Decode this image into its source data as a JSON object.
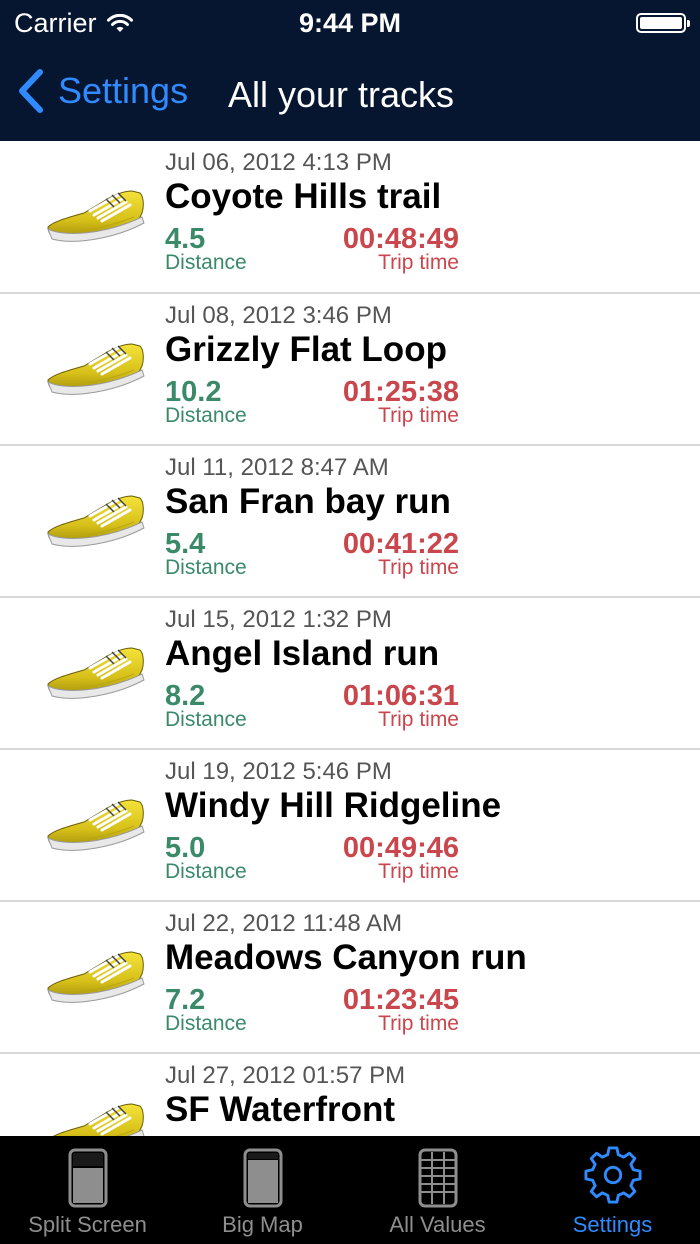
{
  "status_bar": {
    "carrier": "Carrier",
    "time": "9:44 PM",
    "battery_level": 1.0
  },
  "nav": {
    "back_label": "Settings",
    "title": "All your tracks"
  },
  "colors": {
    "header_bg": "#061530",
    "accent": "#2f8bff",
    "distance": "#3a8a6a",
    "trip_time": "#c9464c"
  },
  "tracks": [
    {
      "date": "Jul 06, 2012 4:13 PM",
      "name": "Coyote Hills trail",
      "distance": "4.5",
      "distance_label": "Distance",
      "trip_time": "00:48:49",
      "trip_time_label": "Trip time"
    },
    {
      "date": "Jul 08, 2012 3:46 PM",
      "name": "Grizzly Flat Loop",
      "distance": "10.2",
      "distance_label": "Distance",
      "trip_time": "01:25:38",
      "trip_time_label": "Trip time"
    },
    {
      "date": "Jul 11, 2012 8:47 AM",
      "name": "San Fran bay run",
      "distance": "5.4",
      "distance_label": "Distance",
      "trip_time": "00:41:22",
      "trip_time_label": "Trip time"
    },
    {
      "date": "Jul 15, 2012 1:32 PM",
      "name": "Angel Island run",
      "distance": "8.2",
      "distance_label": "Distance",
      "trip_time": "01:06:31",
      "trip_time_label": "Trip time"
    },
    {
      "date": "Jul 19, 2012 5:46 PM",
      "name": "Windy Hill Ridgeline",
      "distance": "5.0",
      "distance_label": "Distance",
      "trip_time": "00:49:46",
      "trip_time_label": "Trip time"
    },
    {
      "date": "Jul 22, 2012 11:48 AM",
      "name": "Meadows Canyon run",
      "distance": "7.2",
      "distance_label": "Distance",
      "trip_time": "01:23:45",
      "trip_time_label": "Trip time"
    },
    {
      "date": "Jul 27, 2012 01:57 PM",
      "name": "SF Waterfront",
      "distance": "",
      "distance_label": "",
      "trip_time": "",
      "trip_time_label": ""
    }
  ],
  "tabs": [
    {
      "label": "Split Screen",
      "icon": "split-screen-icon",
      "active": false
    },
    {
      "label": "Big Map",
      "icon": "big-map-icon",
      "active": false
    },
    {
      "label": "All Values",
      "icon": "all-values-icon",
      "active": false
    },
    {
      "label": "Settings",
      "icon": "gear-icon",
      "active": true
    }
  ]
}
